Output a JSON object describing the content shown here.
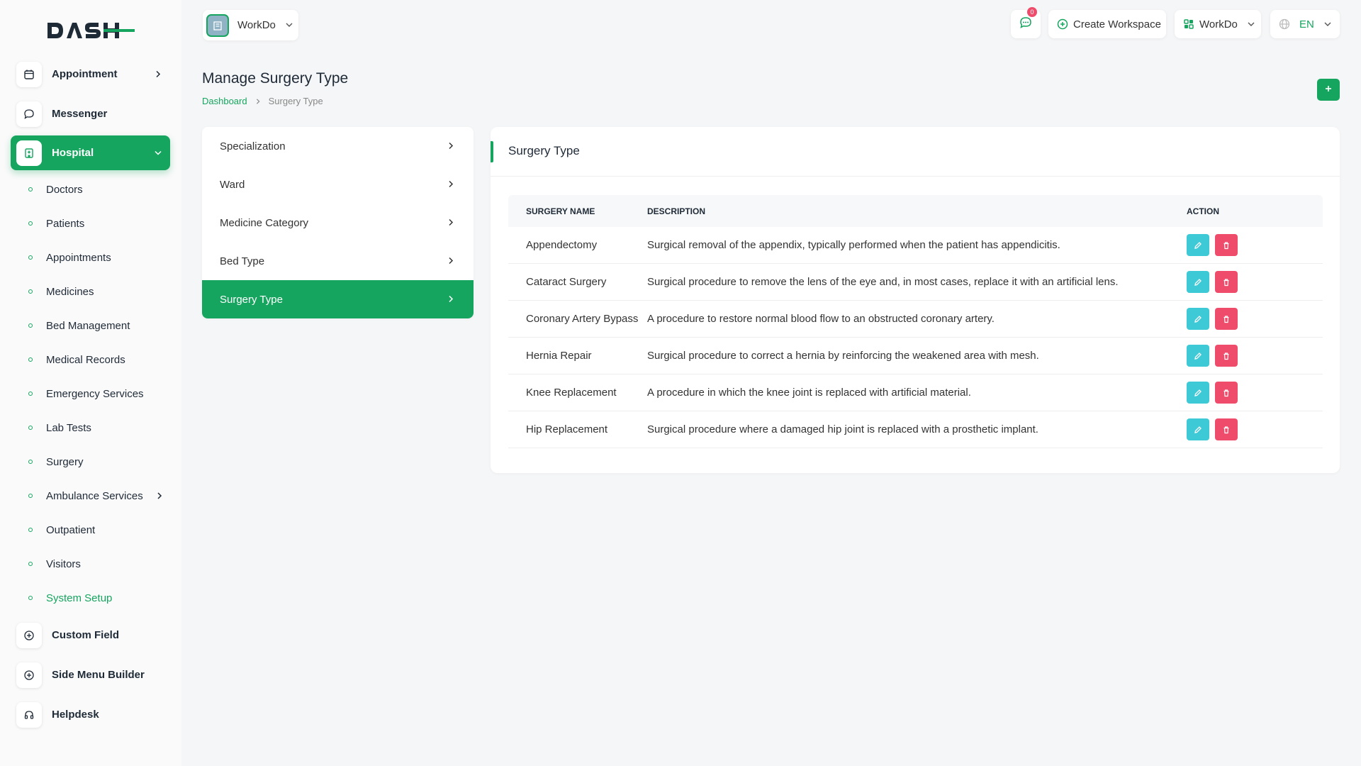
{
  "brand": "DASH",
  "header": {
    "workspace_selector": "WorkDo",
    "notification_count": "0",
    "create_workspace": "Create Workspace",
    "workspace_menu": "WorkDo",
    "language": "EN"
  },
  "sidebar": {
    "top_items": [
      {
        "label": "Appointment"
      },
      {
        "label": "Messenger"
      },
      {
        "label": "Hospital"
      }
    ],
    "sub_items": [
      {
        "label": "Doctors"
      },
      {
        "label": "Patients"
      },
      {
        "label": "Appointments"
      },
      {
        "label": "Medicines"
      },
      {
        "label": "Bed Management"
      },
      {
        "label": "Medical Records"
      },
      {
        "label": "Emergency Services"
      },
      {
        "label": "Lab Tests"
      },
      {
        "label": "Surgery"
      },
      {
        "label": "Ambulance Services"
      },
      {
        "label": "Outpatient"
      },
      {
        "label": "Visitors"
      },
      {
        "label": "System Setup"
      }
    ],
    "bottom_items": [
      {
        "label": "Custom Field"
      },
      {
        "label": "Side Menu Builder"
      },
      {
        "label": "Helpdesk"
      }
    ]
  },
  "page": {
    "title": "Manage Surgery Type",
    "breadcrumb": {
      "home": "Dashboard",
      "current": "Surgery Type"
    }
  },
  "settings_menu": [
    {
      "label": "Specialization"
    },
    {
      "label": "Ward"
    },
    {
      "label": "Medicine Category"
    },
    {
      "label": "Bed Type"
    },
    {
      "label": "Surgery Type"
    }
  ],
  "card": {
    "title": "Surgery Type",
    "columns": {
      "name": "SURGERY NAME",
      "description": "DESCRIPTION",
      "action": "ACTION"
    },
    "rows": [
      {
        "name": "Appendectomy",
        "description": "Surgical removal of the appendix, typically performed when the patient has appendicitis."
      },
      {
        "name": "Cataract Surgery",
        "description": "Surgical procedure to remove the lens of the eye and, in most cases, replace it with an artificial lens."
      },
      {
        "name": "Coronary Artery Bypass",
        "description": "A procedure to restore normal blood flow to an obstructed coronary artery."
      },
      {
        "name": "Hernia Repair",
        "description": "Surgical procedure to correct a hernia by reinforcing the weakened area with mesh."
      },
      {
        "name": "Knee Replacement",
        "description": "A procedure in which the knee joint is replaced with artificial material."
      },
      {
        "name": "Hip Replacement",
        "description": "Surgical procedure where a damaged hip joint is replaced with a prosthetic implant."
      }
    ]
  },
  "colors": {
    "accent": "#16a55f",
    "edit": "#3ec9d6",
    "delete": "#ef4b6b"
  }
}
